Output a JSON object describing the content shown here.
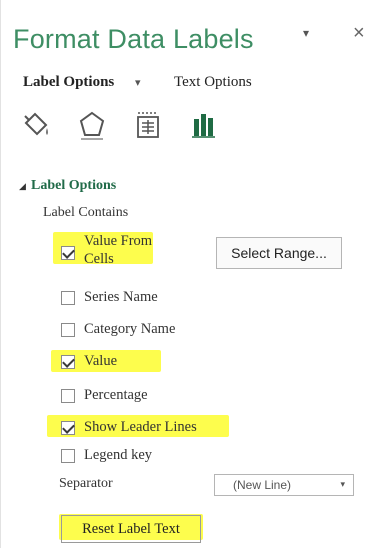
{
  "pane": {
    "title": "Format Data Labels",
    "dropdown_glyph": "▾",
    "close_glyph": "×"
  },
  "tabs": {
    "label_options": "Label Options",
    "text_options": "Text Options",
    "caret": "▾"
  },
  "icons": [
    "fill-line-icon",
    "effects-icon",
    "size-properties-icon",
    "label-options-icon"
  ],
  "section": {
    "caret": "◢",
    "header": "Label Options",
    "label_contains": "Label Contains"
  },
  "checkboxes": [
    {
      "label_line1": "Value From",
      "label_line2": "Cells",
      "checked": true,
      "highlighted": true
    },
    {
      "label": "Series Name",
      "checked": false,
      "highlighted": false
    },
    {
      "label": "Category Name",
      "checked": false,
      "highlighted": false
    },
    {
      "label": "Value",
      "checked": true,
      "highlighted": true
    },
    {
      "label": "Percentage",
      "checked": false,
      "highlighted": false
    },
    {
      "label": "Show Leader Lines",
      "checked": true,
      "highlighted": true
    },
    {
      "label": "Legend key",
      "checked": false,
      "highlighted": false
    }
  ],
  "select_range_button": "Select Range...",
  "separator": {
    "label": "Separator",
    "value": "(New Line)",
    "caret": "▾"
  },
  "reset_button": "Reset Label Text",
  "colors": {
    "title_green": "#3e8e64",
    "header_green": "#216b49",
    "highlight_yellow": "#fdfd3a",
    "bar_icon_green": "#1f6b44"
  }
}
